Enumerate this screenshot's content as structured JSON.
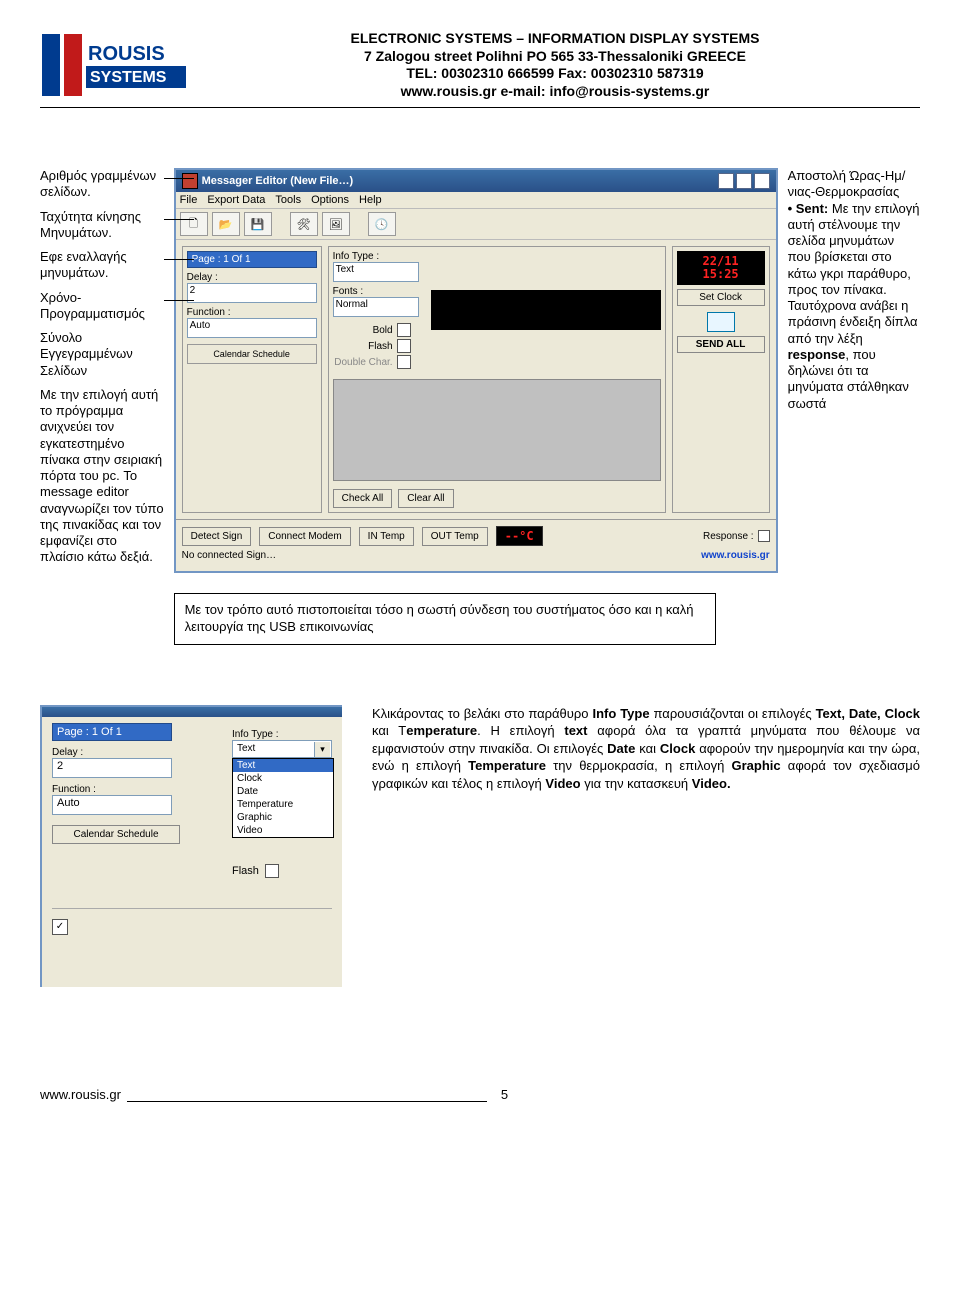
{
  "header": {
    "line1": "ELECTRONIC SYSTEMS – INFORMATION DISPLAY SYSTEMS",
    "line2": "7 Zalogou street Polihni PO 565 33-Thessaloniki GREECE",
    "line3": "TEL: 00302310 666599 Fax: 00302310 587319",
    "line4": "www.rousis.gr e-mail: info@rousis-systems.gr"
  },
  "logo": {
    "top": "ROUSIS",
    "bot": "SYSTEMS"
  },
  "left_notes": {
    "n1": "Αριθμός γραμμένων σελίδων.",
    "n2": "Ταχύτητα κίνησης Μηνυμάτων.",
    "n3": "Εφε εναλλαγής μηνυμάτων.",
    "n4": "Χρόνο-Προγραμματισμός",
    "n5": "Σύνολο Εγγεγραμμένων Σελίδων",
    "n6": "Με την επιλογή αυτή το πρόγραμμα ανιχνεύει τον εγκατεστημένο πίνακα στην σειριακή πόρτα του pc. Το message editor αναγνωρίζει τον τύπο της πινακίδας και τον εμφανίζει στο πλαίσιο κάτω δεξιά."
  },
  "right_notes": {
    "t1": "Αποστολή Ώρας-Ημ/νιας-Θερμοκρασίας",
    "t2a": "• Sent:",
    "t2": " Με την επιλογή αυτή στέλνουμε την σελίδα μηνυμάτων που βρίσκεται στο κάτω γκρι παράθυρο, προς τον πίνακα.",
    "t3a": "Ταυτόχρονα ανάβει η πράσινη ένδειξη δίπλα από την λέξη ",
    "t3r": "response",
    "t3b": ", που δηλώνει ότι τα μηνύματα στάλθηκαν σωστά"
  },
  "under_note": "Με τον τρόπο αυτό πιστοποιείται τόσο η σωστή σύνδεση του συστήματος όσο και η καλή λειτουργία της USB επικοινωνίας",
  "win1": {
    "title": "Messager Editor  (New File…)",
    "menu": [
      "File",
      "Export Data",
      "Tools",
      "Options",
      "Help"
    ],
    "page_btn": "Page : 1 Of 1",
    "delay_lbl": "Delay :",
    "delay_val": "2",
    "func_lbl": "Function :",
    "func_val": "Auto",
    "cal_btn": "Calendar Schedule",
    "info_lbl": "Info Type :",
    "info_val": "Text",
    "fonts_lbl": "Fonts :",
    "fonts_val": "Normal",
    "bold_lbl": "Bold",
    "flash_lbl": "Flash",
    "dblchar_lbl": "Double Char.",
    "checkall": "Check All",
    "clearall": "Clear All",
    "detect": "Detect Sign",
    "modem": "Connect Modem",
    "intemp": "IN Temp",
    "outtemp": "OUT Temp",
    "tempdisp": "--°C",
    "response": "Response :",
    "status": "No connected Sign…",
    "link": "www.rousis.gr",
    "clockdisp_l1": "22/11",
    "clockdisp_l2": "15:25",
    "setclock": "Set Clock",
    "sendall": "SEND ALL"
  },
  "win2": {
    "info_lbl": "Info Type :",
    "page_btn": "Page : 1 Of 1",
    "delay_lbl": "Delay :",
    "delay_val": "2",
    "func_lbl": "Function :",
    "func_val": "Auto",
    "cal_btn": "Calendar Schedule",
    "dd_sel": "Text",
    "dd_opts": [
      "Text",
      "Clock",
      "Date",
      "Temperature",
      "Graphic",
      "Video"
    ],
    "flash_lbl": "Flash"
  },
  "para2": {
    "t1": " Κλικάροντας το βελάκι στο παράθυρο ",
    "b1": "Info Type",
    "t2": " παρουσιάζονται οι επιλογές ",
    "b2": "Text, Date, Clock",
    "t3": " και Τ",
    "b3": "emperature",
    "t4": ". Η επιλογή ",
    "b4": "text",
    "t5": " αφορά όλα τα γραπτά μηνύματα που θέλουμε να εμφανιστούν στην πινακίδα. Οι επιλογές ",
    "b5": "Date",
    "t6": " και ",
    "b6": "Clock",
    "t7": " αφορούν την ημερομηνία και την ώρα, ενώ η επιλογή ",
    "b7": "Temperature",
    "t8": " την θερμοκρασία, η επιλογή ",
    "b8": "Graphic",
    "t9": " αφορά τον σχεδιασμό γραφικών και τέλος η επιλογή ",
    "b9": "Video",
    "t10": " για την κατασκευή ",
    "b10": "Video."
  },
  "footer": {
    "url": "www.rousis.gr",
    "page": "5"
  }
}
